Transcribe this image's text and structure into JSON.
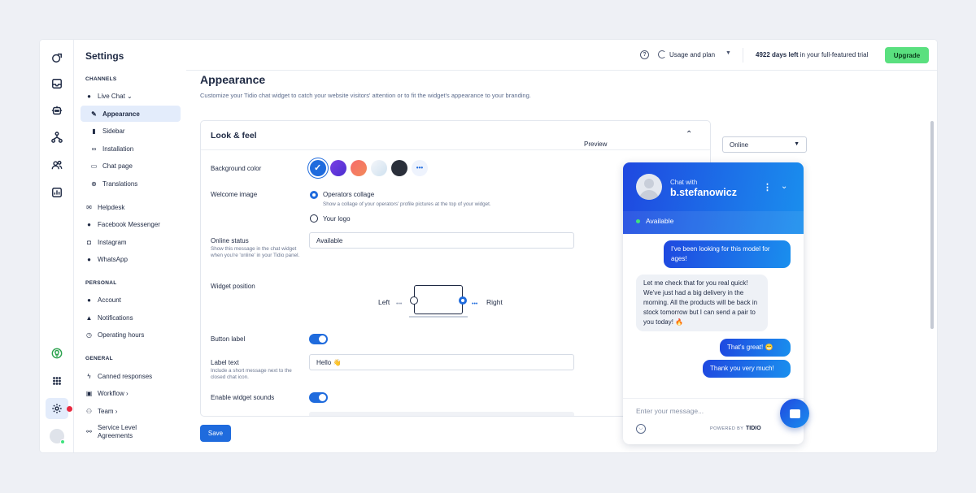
{
  "sidebar": {
    "title": "Settings",
    "sections": {
      "channels": "CHANNELS",
      "personal": "PERSONAL",
      "general": "GENERAL"
    },
    "items": [
      {
        "label": "Live Chat ⌄",
        "icon": "chat-icon"
      },
      {
        "label": "Appearance",
        "icon": "brush-icon"
      },
      {
        "label": "Sidebar",
        "icon": "bookmark-icon"
      },
      {
        "label": "Installation",
        "icon": "link-icon"
      },
      {
        "label": "Chat page",
        "icon": "laptop-icon"
      },
      {
        "label": "Translations",
        "icon": "globe-icon"
      },
      {
        "label": "Helpdesk",
        "icon": "mail-icon"
      },
      {
        "label": "Facebook Messenger",
        "icon": "messenger-icon"
      },
      {
        "label": "Instagram",
        "icon": "instagram-icon"
      },
      {
        "label": "WhatsApp",
        "icon": "whatsapp-icon"
      },
      {
        "label": "Account",
        "icon": "user-icon"
      },
      {
        "label": "Notifications",
        "icon": "bell-icon"
      },
      {
        "label": "Operating hours",
        "icon": "clock-icon"
      },
      {
        "label": "Canned responses",
        "icon": "bolt-icon"
      },
      {
        "label": "Workflow ›",
        "icon": "workflow-icon"
      },
      {
        "label": "Team ›",
        "icon": "team-icon"
      },
      {
        "label": "Service Level Agreements",
        "icon": "sla-icon"
      }
    ]
  },
  "topbar": {
    "help_icon": "?",
    "usage_label": "Usage and plan",
    "trial_bold": "4922 days left",
    "trial_rest": " in your full-featured trial",
    "upgrade_label": "Upgrade"
  },
  "main": {
    "title": "Appearance",
    "description": "Customize your Tidio chat widget to catch your website visitors' attention or to fit the widget's appearance to your branding.",
    "card_title": "Look & feel",
    "background_color_label": "Background color",
    "swatch_colors": [
      "#1f6bdd",
      "#6a3de0",
      "#f0665e",
      "#dde9f3",
      "#2a2f3a"
    ],
    "more_label": "•••",
    "welcome_image_label": "Welcome image",
    "welcome_option1": "Operators collage",
    "welcome_option1_sub": "Show a collage of your operators' profile pictures at the top of your widget.",
    "welcome_option2": "Your logo",
    "online_status_label": "Online status",
    "online_status_sub": "Show this message in the chat widget when you're 'online' in your Tidio panel.",
    "online_status_value": "Available",
    "widget_position_label": "Widget position",
    "position_left": "Left",
    "position_right": "Right",
    "button_label_label": "Button label",
    "label_text_label": "Label text",
    "label_text_sub": "Include a short message next to the closed chat icon.",
    "label_text_value": "Hello 👋",
    "widget_sounds_label": "Enable widget sounds",
    "save_label": "Save"
  },
  "preview": {
    "label": "Preview",
    "select_value": "Online",
    "chat_with": "Chat with",
    "operator": "b.stefanowicz",
    "status": "Available",
    "messages": [
      {
        "from": "visitor",
        "text": "I've been looking for this model for ages!"
      },
      {
        "from": "operator",
        "text": "Let me check that for you real quick! We've just had a big delivery in the morning. All the products will be back in stock tomorrow but I can send a pair to you today! 🔥"
      },
      {
        "from": "visitor",
        "text": "That's great! 😁"
      },
      {
        "from": "visitor",
        "text": "Thank you very much!"
      }
    ],
    "input_placeholder": "Enter your message...",
    "powered_by": "POWERED BY",
    "brand": "TIDIO"
  },
  "colors": {
    "accent": "#1f6bdd",
    "upgrade": "#5ae07f",
    "alert_dot": "#e8283f"
  }
}
